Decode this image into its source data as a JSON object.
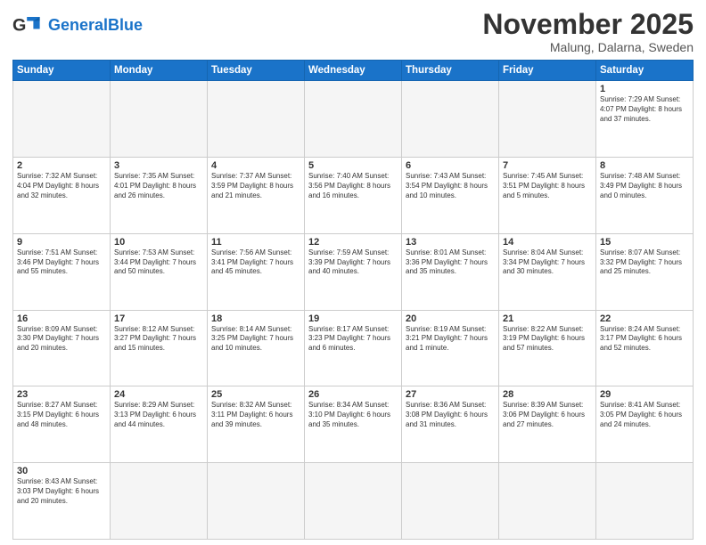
{
  "header": {
    "logo_general": "General",
    "logo_blue": "Blue",
    "month_title": "November 2025",
    "location": "Malung, Dalarna, Sweden"
  },
  "weekdays": [
    "Sunday",
    "Monday",
    "Tuesday",
    "Wednesday",
    "Thursday",
    "Friday",
    "Saturday"
  ],
  "weeks": [
    [
      {
        "day": "",
        "info": "",
        "empty": true
      },
      {
        "day": "",
        "info": "",
        "empty": true
      },
      {
        "day": "",
        "info": "",
        "empty": true
      },
      {
        "day": "",
        "info": "",
        "empty": true
      },
      {
        "day": "",
        "info": "",
        "empty": true
      },
      {
        "day": "",
        "info": "",
        "empty": true
      },
      {
        "day": "1",
        "info": "Sunrise: 7:29 AM\nSunset: 4:07 PM\nDaylight: 8 hours\nand 37 minutes."
      }
    ],
    [
      {
        "day": "2",
        "info": "Sunrise: 7:32 AM\nSunset: 4:04 PM\nDaylight: 8 hours\nand 32 minutes."
      },
      {
        "day": "3",
        "info": "Sunrise: 7:35 AM\nSunset: 4:01 PM\nDaylight: 8 hours\nand 26 minutes."
      },
      {
        "day": "4",
        "info": "Sunrise: 7:37 AM\nSunset: 3:59 PM\nDaylight: 8 hours\nand 21 minutes."
      },
      {
        "day": "5",
        "info": "Sunrise: 7:40 AM\nSunset: 3:56 PM\nDaylight: 8 hours\nand 16 minutes."
      },
      {
        "day": "6",
        "info": "Sunrise: 7:43 AM\nSunset: 3:54 PM\nDaylight: 8 hours\nand 10 minutes."
      },
      {
        "day": "7",
        "info": "Sunrise: 7:45 AM\nSunset: 3:51 PM\nDaylight: 8 hours\nand 5 minutes."
      },
      {
        "day": "8",
        "info": "Sunrise: 7:48 AM\nSunset: 3:49 PM\nDaylight: 8 hours\nand 0 minutes."
      }
    ],
    [
      {
        "day": "9",
        "info": "Sunrise: 7:51 AM\nSunset: 3:46 PM\nDaylight: 7 hours\nand 55 minutes."
      },
      {
        "day": "10",
        "info": "Sunrise: 7:53 AM\nSunset: 3:44 PM\nDaylight: 7 hours\nand 50 minutes."
      },
      {
        "day": "11",
        "info": "Sunrise: 7:56 AM\nSunset: 3:41 PM\nDaylight: 7 hours\nand 45 minutes."
      },
      {
        "day": "12",
        "info": "Sunrise: 7:59 AM\nSunset: 3:39 PM\nDaylight: 7 hours\nand 40 minutes."
      },
      {
        "day": "13",
        "info": "Sunrise: 8:01 AM\nSunset: 3:36 PM\nDaylight: 7 hours\nand 35 minutes."
      },
      {
        "day": "14",
        "info": "Sunrise: 8:04 AM\nSunset: 3:34 PM\nDaylight: 7 hours\nand 30 minutes."
      },
      {
        "day": "15",
        "info": "Sunrise: 8:07 AM\nSunset: 3:32 PM\nDaylight: 7 hours\nand 25 minutes."
      }
    ],
    [
      {
        "day": "16",
        "info": "Sunrise: 8:09 AM\nSunset: 3:30 PM\nDaylight: 7 hours\nand 20 minutes."
      },
      {
        "day": "17",
        "info": "Sunrise: 8:12 AM\nSunset: 3:27 PM\nDaylight: 7 hours\nand 15 minutes."
      },
      {
        "day": "18",
        "info": "Sunrise: 8:14 AM\nSunset: 3:25 PM\nDaylight: 7 hours\nand 10 minutes."
      },
      {
        "day": "19",
        "info": "Sunrise: 8:17 AM\nSunset: 3:23 PM\nDaylight: 7 hours\nand 6 minutes."
      },
      {
        "day": "20",
        "info": "Sunrise: 8:19 AM\nSunset: 3:21 PM\nDaylight: 7 hours\nand 1 minute."
      },
      {
        "day": "21",
        "info": "Sunrise: 8:22 AM\nSunset: 3:19 PM\nDaylight: 6 hours\nand 57 minutes."
      },
      {
        "day": "22",
        "info": "Sunrise: 8:24 AM\nSunset: 3:17 PM\nDaylight: 6 hours\nand 52 minutes."
      }
    ],
    [
      {
        "day": "23",
        "info": "Sunrise: 8:27 AM\nSunset: 3:15 PM\nDaylight: 6 hours\nand 48 minutes."
      },
      {
        "day": "24",
        "info": "Sunrise: 8:29 AM\nSunset: 3:13 PM\nDaylight: 6 hours\nand 44 minutes."
      },
      {
        "day": "25",
        "info": "Sunrise: 8:32 AM\nSunset: 3:11 PM\nDaylight: 6 hours\nand 39 minutes."
      },
      {
        "day": "26",
        "info": "Sunrise: 8:34 AM\nSunset: 3:10 PM\nDaylight: 6 hours\nand 35 minutes."
      },
      {
        "day": "27",
        "info": "Sunrise: 8:36 AM\nSunset: 3:08 PM\nDaylight: 6 hours\nand 31 minutes."
      },
      {
        "day": "28",
        "info": "Sunrise: 8:39 AM\nSunset: 3:06 PM\nDaylight: 6 hours\nand 27 minutes."
      },
      {
        "day": "29",
        "info": "Sunrise: 8:41 AM\nSunset: 3:05 PM\nDaylight: 6 hours\nand 24 minutes."
      }
    ],
    [
      {
        "day": "30",
        "info": "Sunrise: 8:43 AM\nSunset: 3:03 PM\nDaylight: 6 hours\nand 20 minutes."
      },
      {
        "day": "",
        "info": "",
        "empty": true
      },
      {
        "day": "",
        "info": "",
        "empty": true
      },
      {
        "day": "",
        "info": "",
        "empty": true
      },
      {
        "day": "",
        "info": "",
        "empty": true
      },
      {
        "day": "",
        "info": "",
        "empty": true
      },
      {
        "day": "",
        "info": "",
        "empty": true
      }
    ]
  ]
}
